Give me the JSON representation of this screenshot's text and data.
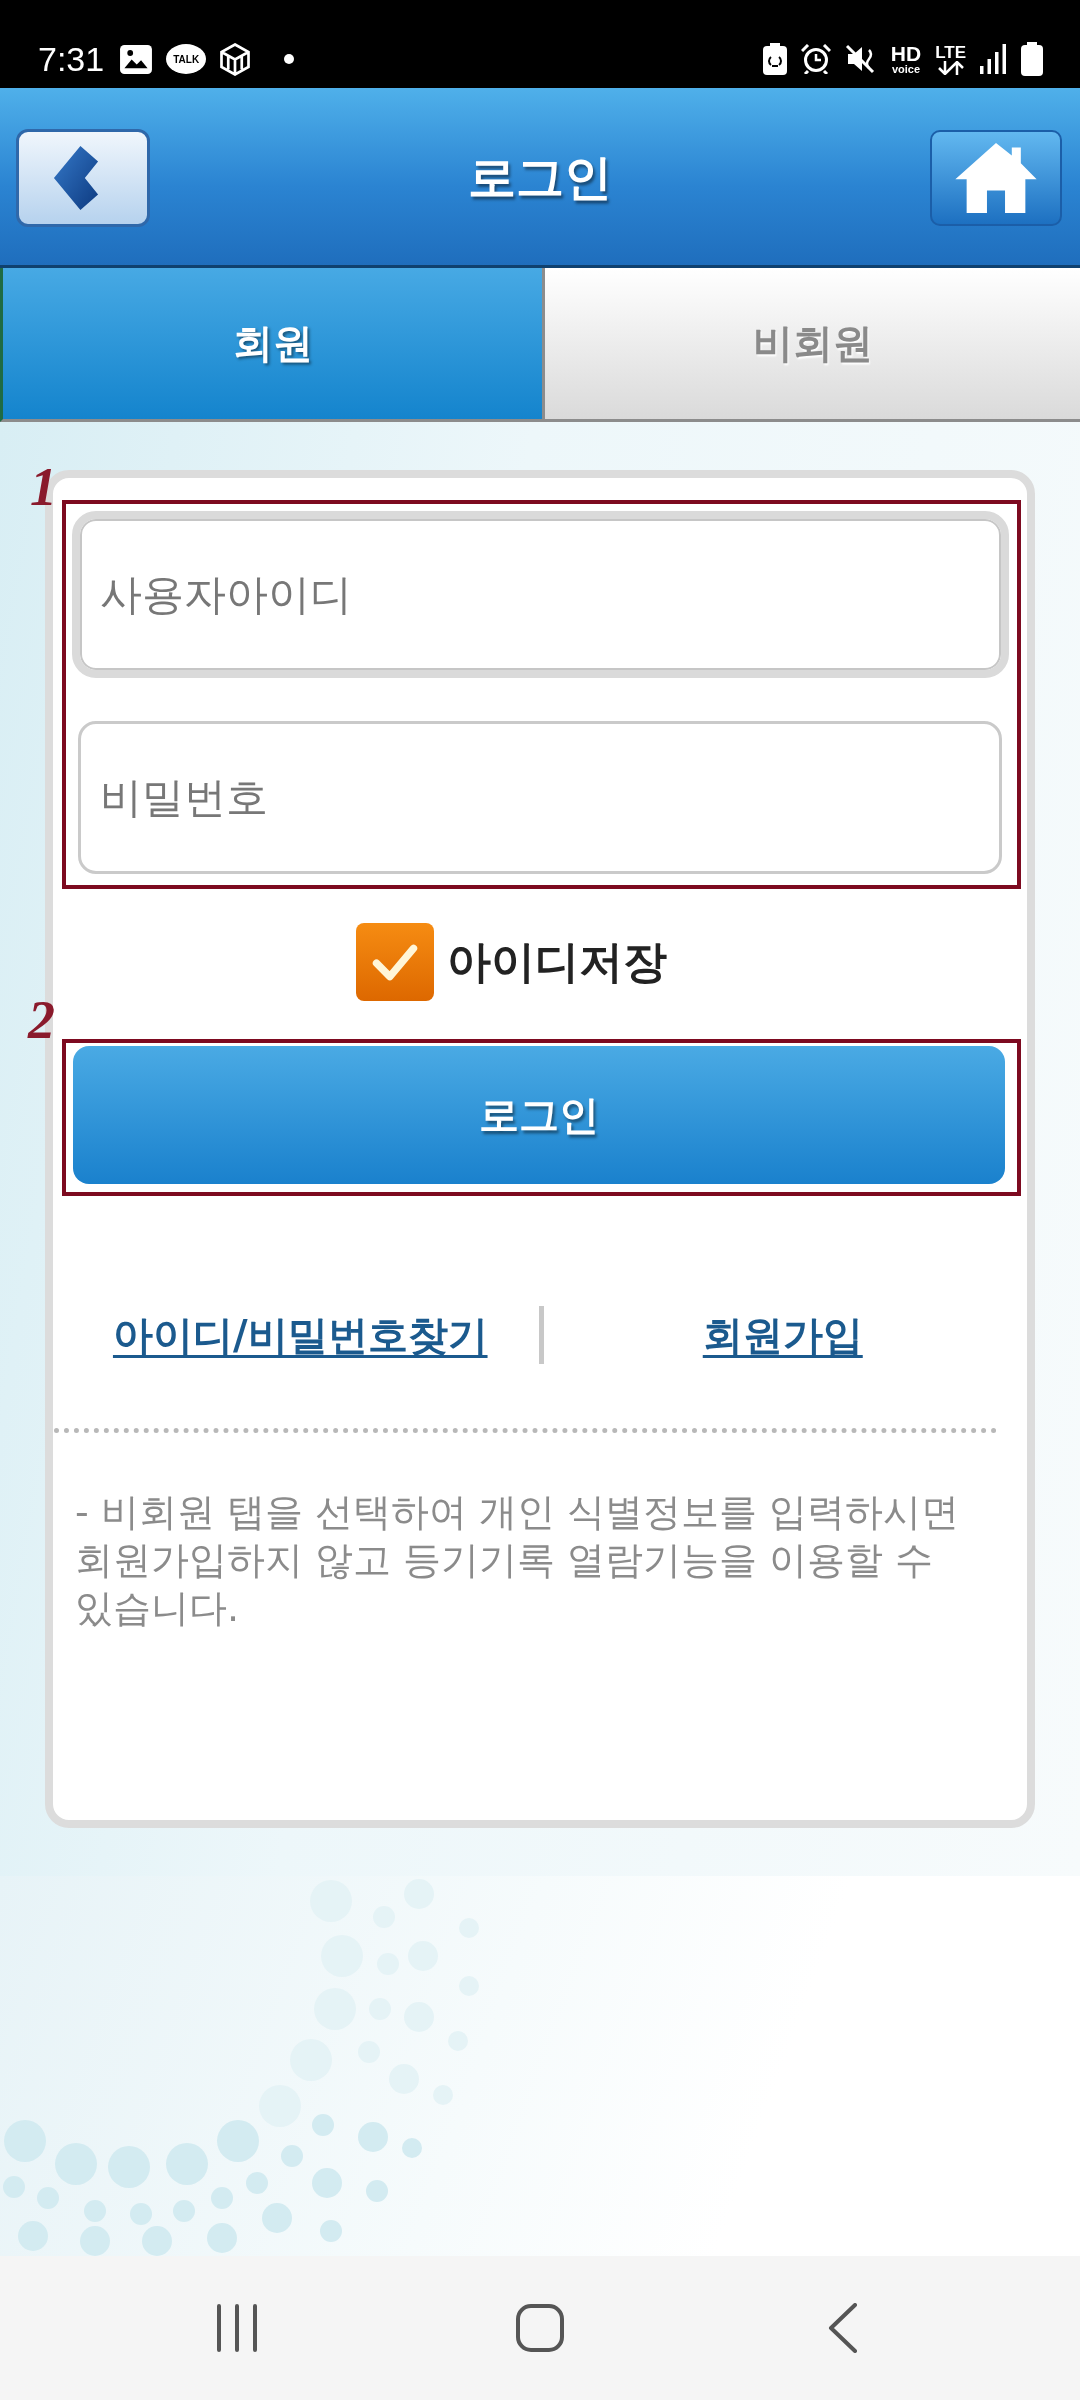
{
  "status_bar": {
    "time": "7:31",
    "app_badge": "TALK",
    "voice_label": "HD",
    "voice_sublabel": "voice",
    "network": "LTE"
  },
  "header": {
    "title": "로그인"
  },
  "tabs": [
    {
      "label": "회원",
      "selected": true
    },
    {
      "label": "비회원",
      "selected": false
    }
  ],
  "login_form": {
    "fields_step": "1",
    "fields": [
      {
        "placeholder": "사용자아이디",
        "focused": true
      },
      {
        "placeholder": "비밀번호",
        "focused": false
      }
    ],
    "save_id": {
      "label": "아이디저장",
      "checked": true
    },
    "button_step": "2",
    "login_button": "로그인"
  },
  "links": [
    "아이디/비밀번호찾기",
    "회원가입"
  ],
  "notice": "- 비회원 탭을 선택하여 개인 식별정보를 입력하시면 회원가입하지 않고 등기기록 열람기능을 이용할 수 있습니다."
}
